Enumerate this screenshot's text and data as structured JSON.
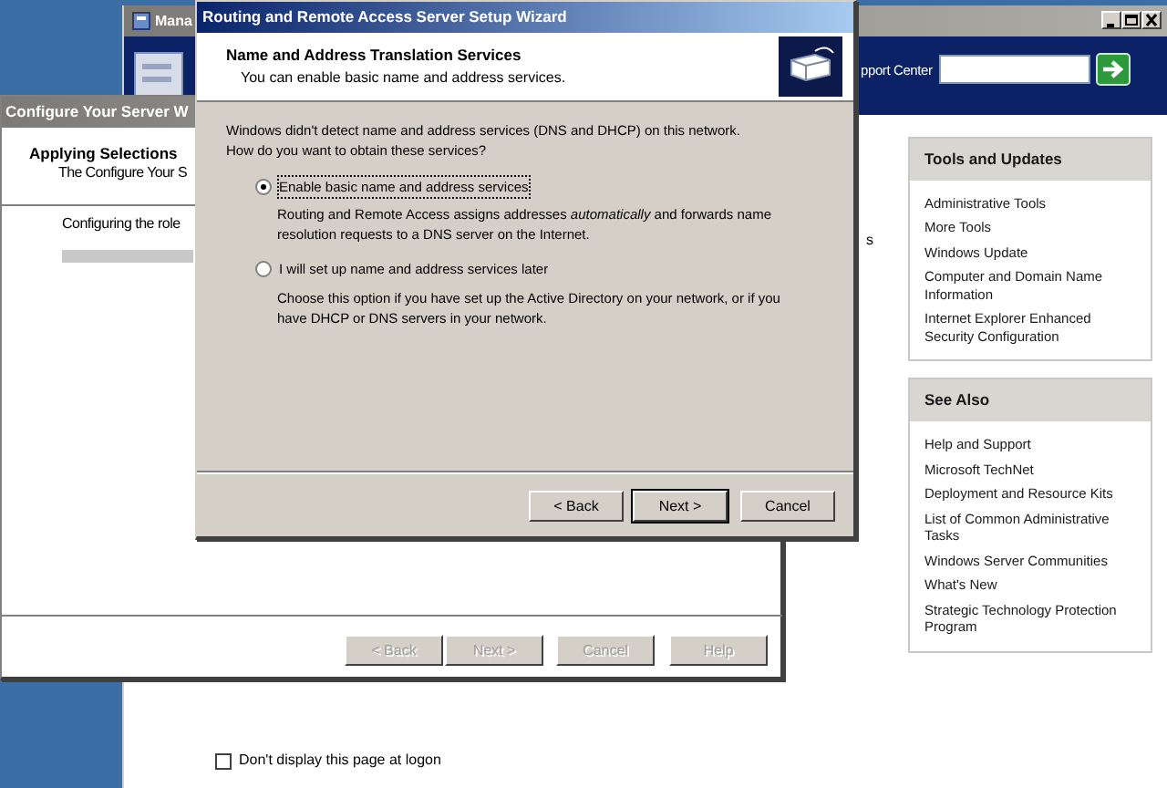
{
  "manage_window": {
    "title": "Mana",
    "banner_text": "pport Center",
    "side_text": "s",
    "panels": [
      {
        "title": "Tools and Updates",
        "links": [
          "Administrative Tools",
          "More Tools",
          "Windows Update",
          "Computer and Domain Name Information",
          "Internet Explorer Enhanced Security Configuration"
        ]
      },
      {
        "title": "See Also",
        "links": [
          "Help and Support",
          "Microsoft TechNet",
          "Deployment and Resource Kits",
          "List of Common Administrative Tasks",
          "Windows Server Communities",
          "What's New",
          "Strategic Technology Protection Program"
        ]
      }
    ],
    "logon_checkbox": {
      "label": "Don't display this page at logon",
      "checked": false
    }
  },
  "configure_wizard": {
    "title": "Configure Your Server W",
    "heading": "Applying Selections",
    "subheading": "The Configure Your S",
    "status": "Configuring the role",
    "progress": {
      "level": 0
    },
    "buttons": [
      {
        "label": "< Back",
        "disabled": true
      },
      {
        "label": "Next >",
        "disabled": true
      },
      {
        "label": "Cancel",
        "disabled": true
      },
      {
        "label": "Help",
        "disabled": true
      }
    ]
  },
  "rras_wizard": {
    "title": "Routing and Remote Access Server Setup Wizard",
    "heading": "Name and Address Translation Services",
    "subheading": "You can enable basic name and address services.",
    "intro": [
      "Windows didn't detect name and address services (DNS and DHCP) on this network.",
      "How do you want to obtain these services?"
    ],
    "options": [
      {
        "label": "Enable basic name and address services",
        "selected": true,
        "description": "Routing and Remote Access assigns addresses *automatically* and forwards name resolution requests to a DNS server on the Internet."
      },
      {
        "label": "I will set up name and address services later",
        "selected": false,
        "description": "Choose this option if you have set up the Active Directory on your network, or if you have DHCP or DNS servers in your network."
      }
    ],
    "buttons": [
      {
        "label": "< Back",
        "default": false
      },
      {
        "label": "Next >",
        "default": true
      },
      {
        "label": "Cancel",
        "default": false
      }
    ]
  }
}
